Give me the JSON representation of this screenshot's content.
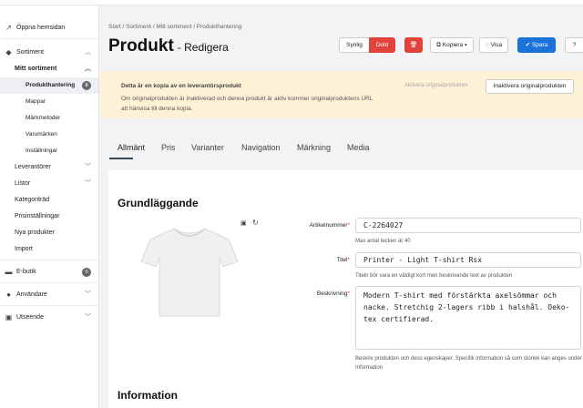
{
  "sidebar": {
    "open_site": "Öppna hemsidan",
    "sortiment": "Sortiment",
    "mitt_sortiment": "Mitt sortiment",
    "items": [
      {
        "label": "Produkthantering",
        "badge": "0"
      },
      {
        "label": "Mappar"
      },
      {
        "label": "Märkmetoder"
      },
      {
        "label": "Varumärken"
      },
      {
        "label": "Inställningar"
      }
    ],
    "leverantorer": "Leverantörer",
    "listor": "Listor",
    "kategoritrad": "Kategoriträd",
    "prisinstallningar": "Prisinställningar",
    "nya_produkter": "Nya produkter",
    "import": "Import",
    "ebutik": "E-butik",
    "ebutik_badge": "0",
    "anvandare": "Användare",
    "utseende": "Utseende"
  },
  "header": {
    "breadcrumb": "Start / Sortiment / Mitt sortiment / Produkthantering",
    "title": "Produkt",
    "subtitle": "- Redigera",
    "visible_label": "Synlig",
    "hidden_label": "Dold",
    "copy_label": "Kopiera",
    "view_label": "Visa",
    "save_label": "Spara"
  },
  "alert": {
    "title": "Detta är en kopia av en leverantörsprodukt",
    "text": "Om originalprodukten är inaktiverad och denna produkt är aktiv kommer originalproduktens URL att hänvisa till denna kopia.",
    "status": "Aktivera originalprodukten",
    "button": "Inaktivera originalprodukten"
  },
  "tabs": [
    "Allmänt",
    "Pris",
    "Varianter",
    "Navigation",
    "Märkning",
    "Media"
  ],
  "form": {
    "section_title": "Grundläggande",
    "article_label": "Artikelnummer",
    "article_value": "C-2264027",
    "article_help": "Max antal tecken är 40",
    "title_label": "Titel",
    "title_value": "Printer - Light T-shirt Rsx",
    "title_help": "Titeln bör vara en väldigt kort men beskrivande text av produkten",
    "desc_label": "Beskrivning",
    "desc_value": "Modern T-shirt med förstärkta axelsömmar och nacke. Stretchig 2-lagers ribb i halshål. Oeko-tex certifierad.",
    "desc_help": "Beskriv produkten och dess egenskaper. Specifik information så som storlek kan anges under Information",
    "next_section": "Information"
  },
  "colors": {
    "accent": "#1a73d9",
    "danger": "#e0433a",
    "alert_bg": "#fdf2d6"
  }
}
